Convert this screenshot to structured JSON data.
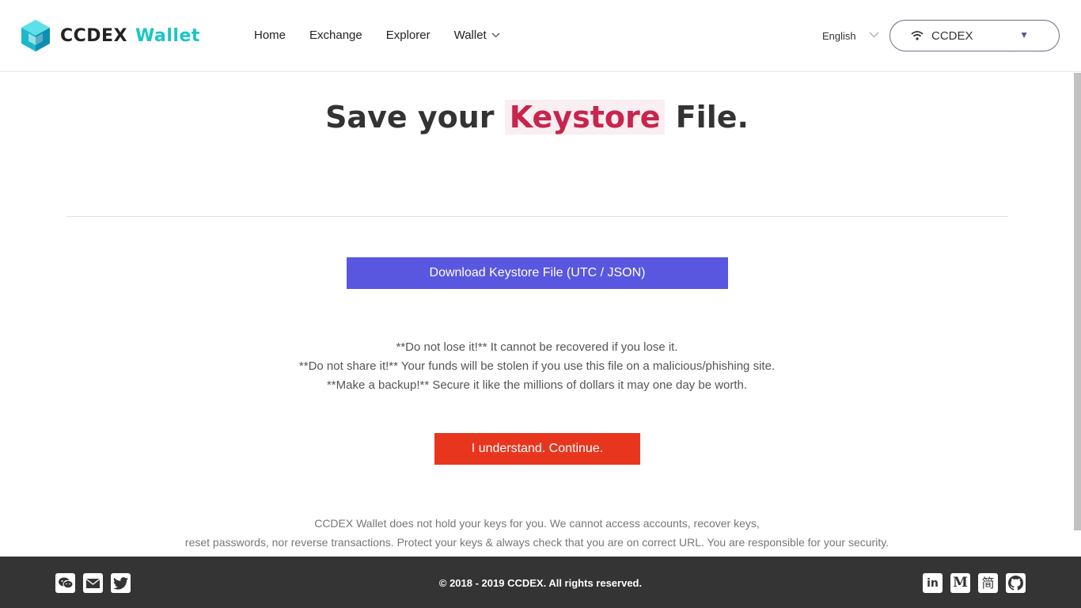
{
  "header": {
    "logo_text_main": "CCDEX",
    "logo_text_accent": "Wallet",
    "nav": [
      {
        "label": "Home"
      },
      {
        "label": "Exchange"
      },
      {
        "label": "Explorer"
      },
      {
        "label": "Wallet"
      }
    ],
    "language": "English",
    "network": "CCDEX"
  },
  "main": {
    "title_prefix": "Save your",
    "title_highlight": "Keystore",
    "title_suffix": "File.",
    "download_button": "Download Keystore File (UTC / JSON)",
    "warnings": [
      "**Do not lose it!** It cannot be recovered if you lose it.",
      "**Do not share it!** Your funds will be stolen if you use this file on a malicious/phishing site.",
      "**Make a backup!** Secure it like the millions of dollars it may one day be worth."
    ],
    "continue_button": "I understand. Continue.",
    "disclaimer": [
      "CCDEX Wallet does not hold your keys for you. We cannot access accounts, recover keys,",
      "reset passwords, nor reverse transactions. Protect your keys & always check that you are on correct URL. You are responsible for your security."
    ]
  },
  "footer": {
    "copyright": "© 2018 - 2019 CCDEX. All rights reserved.",
    "left_icons": [
      "wechat-icon",
      "mail-icon",
      "twitter-icon"
    ],
    "right_icons": [
      "linkedin-icon",
      "medium-icon",
      "jianshu-icon",
      "github-icon"
    ],
    "linkedin_glyph": "in",
    "medium_glyph": "M",
    "jianshu_glyph": "简"
  },
  "colors": {
    "accent": "#19c6c6",
    "primary_button": "#5957e0",
    "danger_button": "#e8361e",
    "highlight_text": "#c7254e",
    "footer_bg": "#343434"
  }
}
